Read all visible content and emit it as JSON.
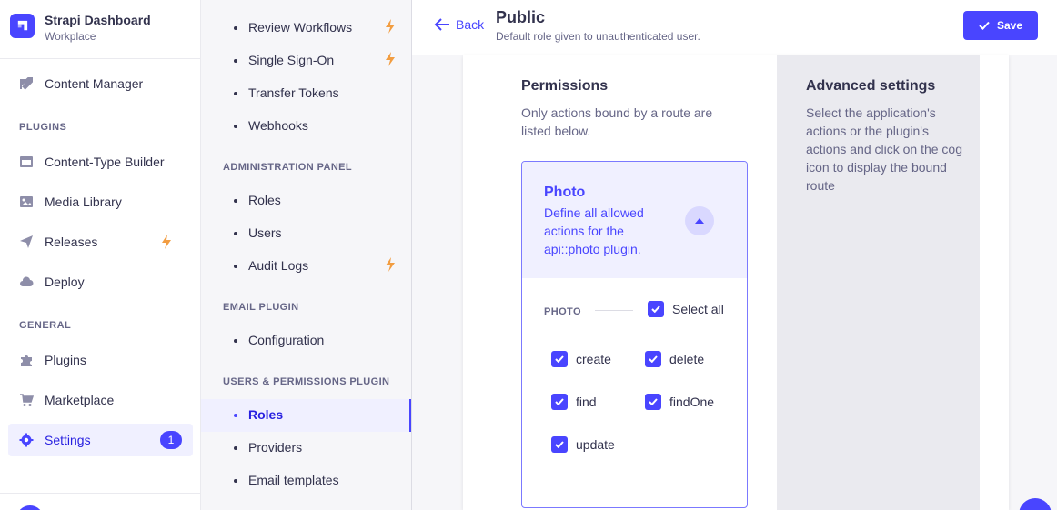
{
  "brand": {
    "title": "Strapi Dashboard",
    "subtitle": "Workplace"
  },
  "mainnav": {
    "content_manager": "Content Manager",
    "plugins_section": "PLUGINS",
    "content_type_builder": "Content-Type Builder",
    "media_library": "Media Library",
    "releases": "Releases",
    "deploy": "Deploy",
    "general_section": "GENERAL",
    "plugins": "Plugins",
    "marketplace": "Marketplace",
    "settings": "Settings",
    "settings_badge": "1"
  },
  "subnav": {
    "items_top": [
      "Review Workflows",
      "Single Sign-On",
      "Transfer Tokens",
      "Webhooks"
    ],
    "admin_section": "ADMINISTRATION PANEL",
    "admin_items": [
      "Roles",
      "Users",
      "Audit Logs"
    ],
    "email_section": "EMAIL PLUGIN",
    "email_items": [
      "Configuration"
    ],
    "up_section": "USERS & PERMISSIONS PLUGIN",
    "up_items": [
      "Roles",
      "Providers",
      "Email templates"
    ]
  },
  "header": {
    "back": "Back",
    "title": "Public",
    "subtitle": "Default role given to unauthenticated user.",
    "save": "Save"
  },
  "permissions": {
    "title": "Permissions",
    "description": "Only actions bound by a route are listed below.",
    "accordion": {
      "title": "Photo",
      "description": "Define all allowed actions for the api::photo plugin.",
      "group_label": "PHOTO",
      "select_all": "Select all",
      "actions": [
        "create",
        "delete",
        "find",
        "findOne",
        "update"
      ]
    }
  },
  "advanced": {
    "title": "Advanced settings",
    "description": "Select the application's actions or the plugin's actions and click on the cog icon to display the bound route"
  },
  "colors": {
    "primary": "#4945ff",
    "bolt": "#f29d41"
  }
}
